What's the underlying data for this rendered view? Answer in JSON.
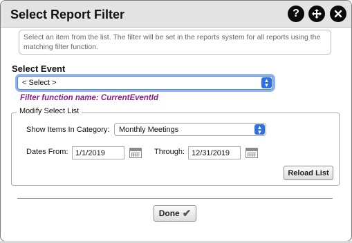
{
  "dialog": {
    "title": "Select Report Filter",
    "help_icon_glyph": "?",
    "move_icon_glyph": "✥",
    "close_icon_glyph": "✕"
  },
  "info_text": "Select an item from the list. The filter will be set in the reports system for all reports using the matching filter function.",
  "event": {
    "label": "Select Event",
    "selected": "< Select >"
  },
  "filter_function": "Filter function name: CurrentEventId",
  "modify": {
    "legend": "Modify Select List",
    "category_label": "Show Items In Category:",
    "category_selected": "Monthly Meetings",
    "dates_from_label": "Dates From:",
    "dates_from_value": "1/1/2019",
    "through_label": "Through:",
    "through_value": "12/31/2019",
    "reload_label": "Reload List"
  },
  "done_label": "Done",
  "colors": {
    "function_name": "#8a1f85",
    "select_arrow": "#2f6fe0",
    "titlebar": "#e4e4e4"
  }
}
